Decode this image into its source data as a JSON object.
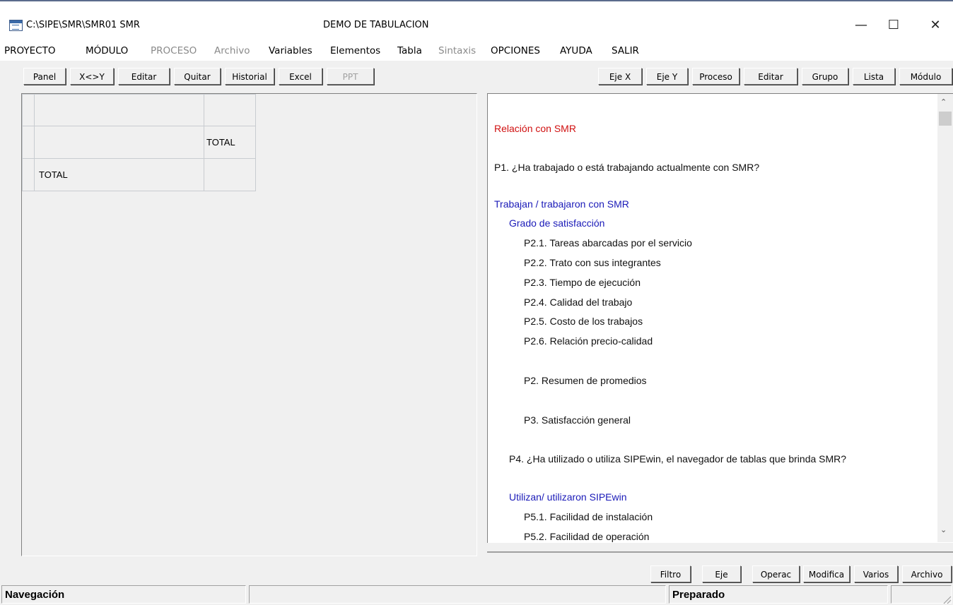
{
  "window": {
    "path": "C:\\SIPE\\SMR\\SMR01 SMR",
    "title": "DEMO DE TABULACION",
    "minimize": "—",
    "maximize": "☐",
    "close": "✕"
  },
  "menu": [
    {
      "label": "PROYECTO",
      "enabled": true
    },
    {
      "label": "MÓDULO",
      "enabled": true
    },
    {
      "label": "PROCESO",
      "enabled": false
    },
    {
      "label": "Archivo",
      "enabled": false
    },
    {
      "label": "Variables",
      "enabled": true
    },
    {
      "label": "Elementos",
      "enabled": true
    },
    {
      "label": "Tabla",
      "enabled": true
    },
    {
      "label": "Sintaxis",
      "enabled": false
    },
    {
      "label": "OPCIONES",
      "enabled": true
    },
    {
      "label": "AYUDA",
      "enabled": true
    },
    {
      "label": "SALIR",
      "enabled": true
    }
  ],
  "toolbar_left": [
    {
      "label": "Panel",
      "enabled": true
    },
    {
      "label": "X<>Y",
      "enabled": true
    },
    {
      "label": "Editar",
      "enabled": true
    },
    {
      "label": "Quitar",
      "enabled": true
    },
    {
      "label": "Historial",
      "enabled": true
    },
    {
      "label": "Excel",
      "enabled": true
    },
    {
      "label": "PPT",
      "enabled": false
    }
  ],
  "toolbar_right": [
    {
      "label": "Eje X"
    },
    {
      "label": "Eje Y"
    },
    {
      "label": "Proceso"
    },
    {
      "label": "Editar"
    },
    {
      "label": "Grupo"
    },
    {
      "label": "Lista"
    },
    {
      "label": "Módulo"
    }
  ],
  "grid": {
    "column_total": "TOTAL",
    "row_total": "TOTAL"
  },
  "outline": [
    {
      "text": "Relación con SMR",
      "style": "red",
      "level": 0
    },
    {
      "text": "P1. ¿Ha trabajado o está trabajando actualmente con SMR?",
      "style": "black",
      "level": 0
    },
    {
      "text": "Trabajan / trabajaron con SMR",
      "style": "blue",
      "level": 0
    },
    {
      "text": "Grado de satisfacción",
      "style": "blue",
      "level": 1
    },
    {
      "text": "P2.1. Tareas abarcadas por el servicio",
      "style": "black",
      "level": 2
    },
    {
      "text": "P2.2. Trato con sus integrantes",
      "style": "black",
      "level": 2
    },
    {
      "text": "P2.3. Tiempo de ejecución",
      "style": "black",
      "level": 2
    },
    {
      "text": "P2.4. Calidad del trabajo",
      "style": "black",
      "level": 2
    },
    {
      "text": "P2.5. Costo de los trabajos",
      "style": "black",
      "level": 2
    },
    {
      "text": "P2.6. Relación precio-calidad",
      "style": "black",
      "level": 2
    },
    {
      "text": "P2. Resumen de promedios",
      "style": "black",
      "level": 2
    },
    {
      "text": "P3. Satisfacción general",
      "style": "black",
      "level": 2
    },
    {
      "text": "P4. ¿Ha utilizado o utiliza SIPEwin, el navegador de tablas que brinda SMR?",
      "style": "black",
      "level": 1
    },
    {
      "text": "Utilizan/ utilizaron SIPEwin",
      "style": "blue",
      "level": 1
    },
    {
      "text": "P5.1. Facilidad de instalación",
      "style": "black",
      "level": 2
    },
    {
      "text": "P5.2. Facilidad de operación",
      "style": "black",
      "level": 2
    }
  ],
  "toolbar_bottom": [
    {
      "label": "Filtro"
    },
    {
      "label": "Eje"
    },
    {
      "label": "Operac"
    },
    {
      "label": "Modifica"
    },
    {
      "label": "Varios"
    },
    {
      "label": "Archivo"
    }
  ],
  "status": {
    "left": "Navegación",
    "middle": "",
    "right": "Preparado"
  },
  "colors": {
    "red": "#d01010",
    "blue": "#1a1ab8",
    "black": "#111111"
  }
}
